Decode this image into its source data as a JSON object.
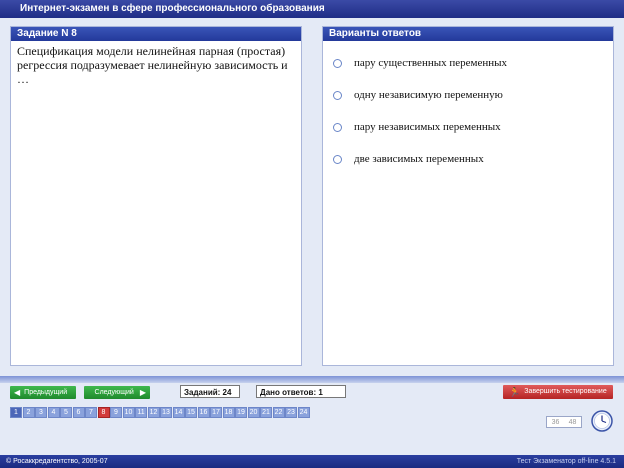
{
  "window": {
    "title": "Интернет-экзамен в сфере профессионального образования"
  },
  "question_panel": {
    "header": "Задание N 8",
    "text": "Спецификация модели нелинейная парная (простая) регрессия подразумевает нелинейную зависимость и …"
  },
  "answers_panel": {
    "header": "Варианты ответов",
    "options": [
      "пару существенных переменных",
      "одну независимую переменную",
      "пару независимых переменных",
      "две зависимых переменных"
    ]
  },
  "nav": {
    "prev_label": "Предыдущий",
    "next_label": "Следующий"
  },
  "stats": {
    "tasks": "Заданий: 24",
    "answered": "Дано ответов: 1"
  },
  "finish_label": "Завершить тестирование",
  "pages": [
    "1",
    "2",
    "3",
    "4",
    "5",
    "6",
    "7",
    "8",
    "9",
    "10",
    "11",
    "12",
    "13",
    "14",
    "15",
    "16",
    "17",
    "18",
    "19",
    "20",
    "21",
    "22",
    "23",
    "24"
  ],
  "current_page": "8",
  "timer": {
    "minutes": "36",
    "seconds": "48"
  },
  "footer": {
    "left": "© Росаккредагентство, 2005-07",
    "right": "Тест Экзаменатор off-line 4.5.1"
  },
  "colors": {
    "header_blue": "#23399a",
    "nav_green": "#1f8a2c",
    "finish_red": "#b52424",
    "active_page": "#d23a3a"
  }
}
